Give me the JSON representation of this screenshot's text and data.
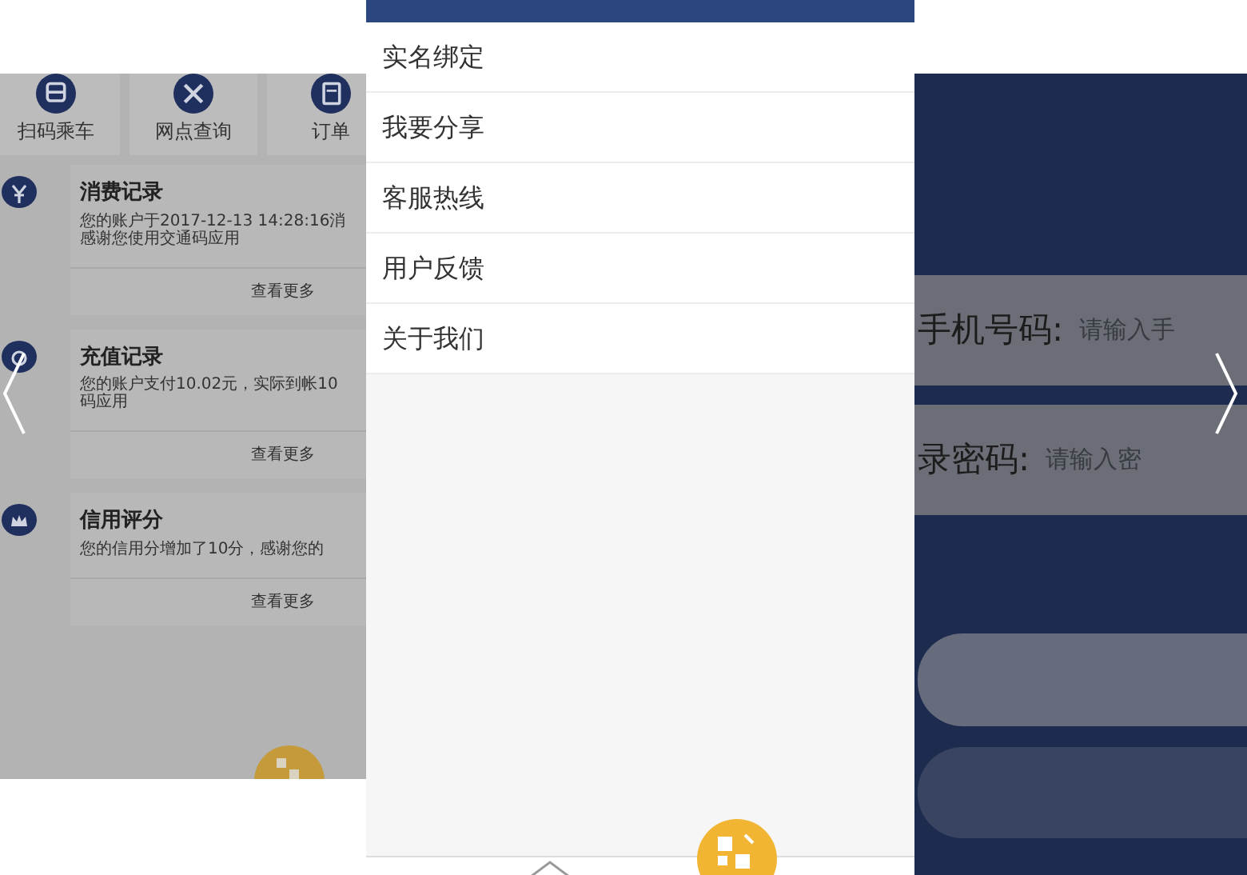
{
  "slides": [
    {
      "kind": "records",
      "selected": false,
      "shortcuts": [
        {
          "label": "扫码乘车"
        },
        {
          "label": "网点查询"
        },
        {
          "label": "订单"
        }
      ],
      "records": [
        {
          "title": "消费记录",
          "lines": [
            "您的账户于2017-12-13 14:28:16消",
            "感谢您使用交通码应用"
          ],
          "more": "查看更多"
        },
        {
          "title": "充值记录",
          "lines": [
            "您的账户支付10.02元，实际到帐10",
            "码应用"
          ],
          "more": "查看更多"
        },
        {
          "title": "信用评分",
          "lines": [
            "您的信用分增加了10分，感谢您的"
          ],
          "more": "查看更多"
        }
      ]
    },
    {
      "kind": "menu",
      "selected": true,
      "items": [
        {
          "label": "实名绑定"
        },
        {
          "label": "我要分享"
        },
        {
          "label": "客服热线"
        },
        {
          "label": "用户反馈"
        },
        {
          "label": "关于我们"
        }
      ]
    },
    {
      "kind": "login",
      "selected": false,
      "fields": [
        {
          "label": "手机号码:",
          "placeholder": "请输入手"
        },
        {
          "label": "录密码:",
          "placeholder": "请输入密"
        }
      ]
    }
  ]
}
